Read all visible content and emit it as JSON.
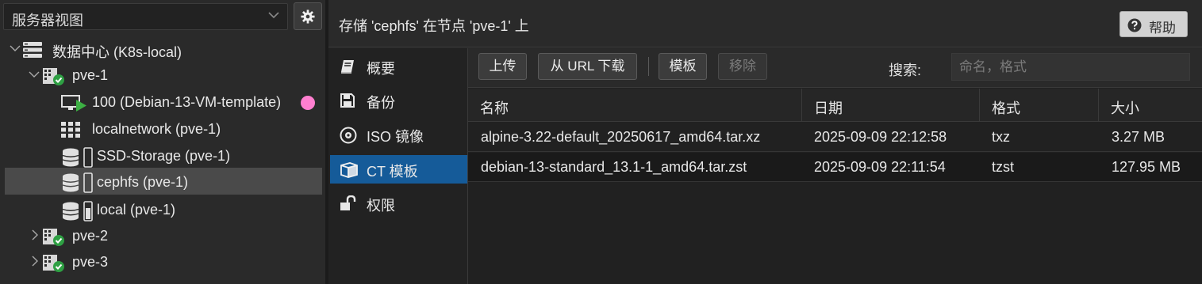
{
  "left": {
    "view_selector": "服务器视图",
    "tree": [
      {
        "label": "数据中心 (K8s-local)"
      },
      {
        "label": "pve-1"
      },
      {
        "label": "100 (Debian-13-VM-template)"
      },
      {
        "label": "localnetwork (pve-1)"
      },
      {
        "label": "SSD-Storage (pve-1)"
      },
      {
        "label": "cephfs (pve-1)"
      },
      {
        "label": "local (pve-1)"
      },
      {
        "label": "pve-2"
      },
      {
        "label": "pve-3"
      }
    ]
  },
  "header": {
    "title": "存储 'cephfs' 在节点 'pve-1' 上",
    "help_label": "帮助"
  },
  "tabs": [
    {
      "label": "概要",
      "icon": "book-icon"
    },
    {
      "label": "备份",
      "icon": "floppy-icon"
    },
    {
      "label": "ISO 镜像",
      "icon": "disc-icon"
    },
    {
      "label": "CT 模板",
      "icon": "cube-icon"
    },
    {
      "label": "权限",
      "icon": "unlock-icon"
    }
  ],
  "toolbar": {
    "upload": "上传",
    "download_url": "从 URL 下载",
    "templates": "模板",
    "remove": "移除",
    "search_label": "搜索:",
    "search_placeholder": "命名，格式"
  },
  "table": {
    "columns": [
      "名称",
      "日期",
      "格式",
      "大小"
    ],
    "rows": [
      [
        "alpine-3.22-default_20250617_amd64.tar.xz",
        "2025-09-09 22:12:58",
        "txz",
        "3.27 MB"
      ],
      [
        "debian-13-standard_13.1-1_amd64.tar.zst",
        "2025-09-09 22:11:54",
        "tzst",
        "127.95 MB"
      ]
    ]
  },
  "colors": {
    "selected_tab": "#155b99",
    "status_ok": "#2ea043",
    "vm_arrow": "#3cb043",
    "tag_pink": "#ff7fd0"
  }
}
